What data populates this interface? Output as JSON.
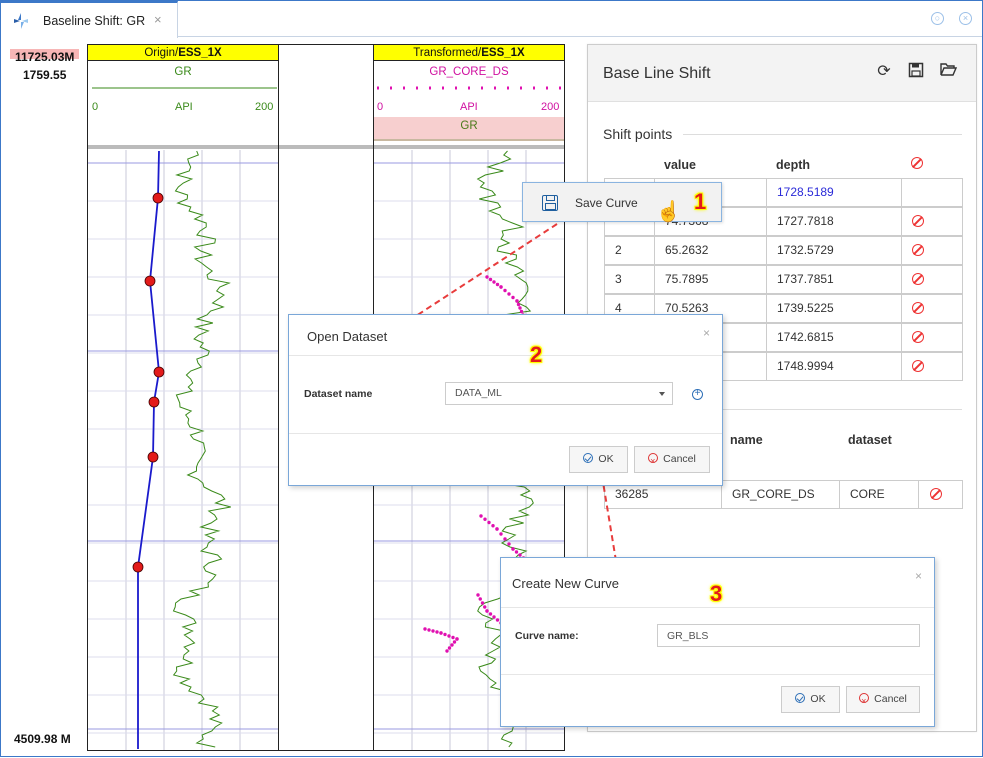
{
  "tab": {
    "label": "Baseline Shift: GR",
    "close": "×"
  },
  "depth": {
    "top": "11725.03M",
    "top2": "1759.55",
    "bottom": "4509.98 M"
  },
  "track1": {
    "title_prefix": "Origin/",
    "title_well": "ESS_1X",
    "curve": "GR",
    "scale_min": "0",
    "scale_unit": "API",
    "scale_max": "200"
  },
  "track2": {
    "title_prefix": "Transformed/",
    "title_well": "ESS_1X",
    "curve": "GR_CORE_DS",
    "scale_min": "0",
    "scale_unit": "API",
    "scale_max": "200",
    "band_label": "GR"
  },
  "panel": {
    "title": "Base Line Shift",
    "section_shift": "Shift points",
    "headers": {
      "value": "value",
      "depth": "depth"
    },
    "rows": [
      {
        "index": "",
        "value": "",
        "depth": "1728.5189",
        "deletable": false
      },
      {
        "index": "",
        "value": "74.7368",
        "depth": "1727.7818",
        "deletable": true
      },
      {
        "index": "2",
        "value": "65.2632",
        "depth": "1732.5729",
        "deletable": true
      },
      {
        "index": "3",
        "value": "75.7895",
        "depth": "1737.7851",
        "deletable": true
      },
      {
        "index": "4",
        "value": "70.5263",
        "depth": "1739.5225",
        "deletable": true
      },
      {
        "index": "",
        "value": "",
        "depth": "1742.6815",
        "deletable": true
      },
      {
        "index": "",
        "value": "",
        "depth": "1748.9994",
        "deletable": true
      }
    ],
    "headers2": {
      "name": "name",
      "dataset": "dataset"
    },
    "curve_row": {
      "id": "36285",
      "name": "GR_CORE_DS",
      "dataset": "CORE"
    }
  },
  "context_menu": {
    "item": "Save Curve"
  },
  "open_dataset": {
    "title": "Open Dataset",
    "label": "Dataset name",
    "value": "DATA_ML",
    "ok": "OK",
    "cancel": "Cancel"
  },
  "create_curve": {
    "title": "Create New Curve",
    "label": "Curve name:",
    "value": "GR_BLS",
    "ok": "OK",
    "cancel": "Cancel"
  },
  "steps": [
    "1",
    "2",
    "3"
  ],
  "colors": {
    "accent": "#3c78c8",
    "gr_curve": "#3a8a1a",
    "core_dots": "#e010b0",
    "shift_line": "#1a1acc",
    "shift_points": "#e31b1b",
    "title_bar": "#ffff00"
  }
}
